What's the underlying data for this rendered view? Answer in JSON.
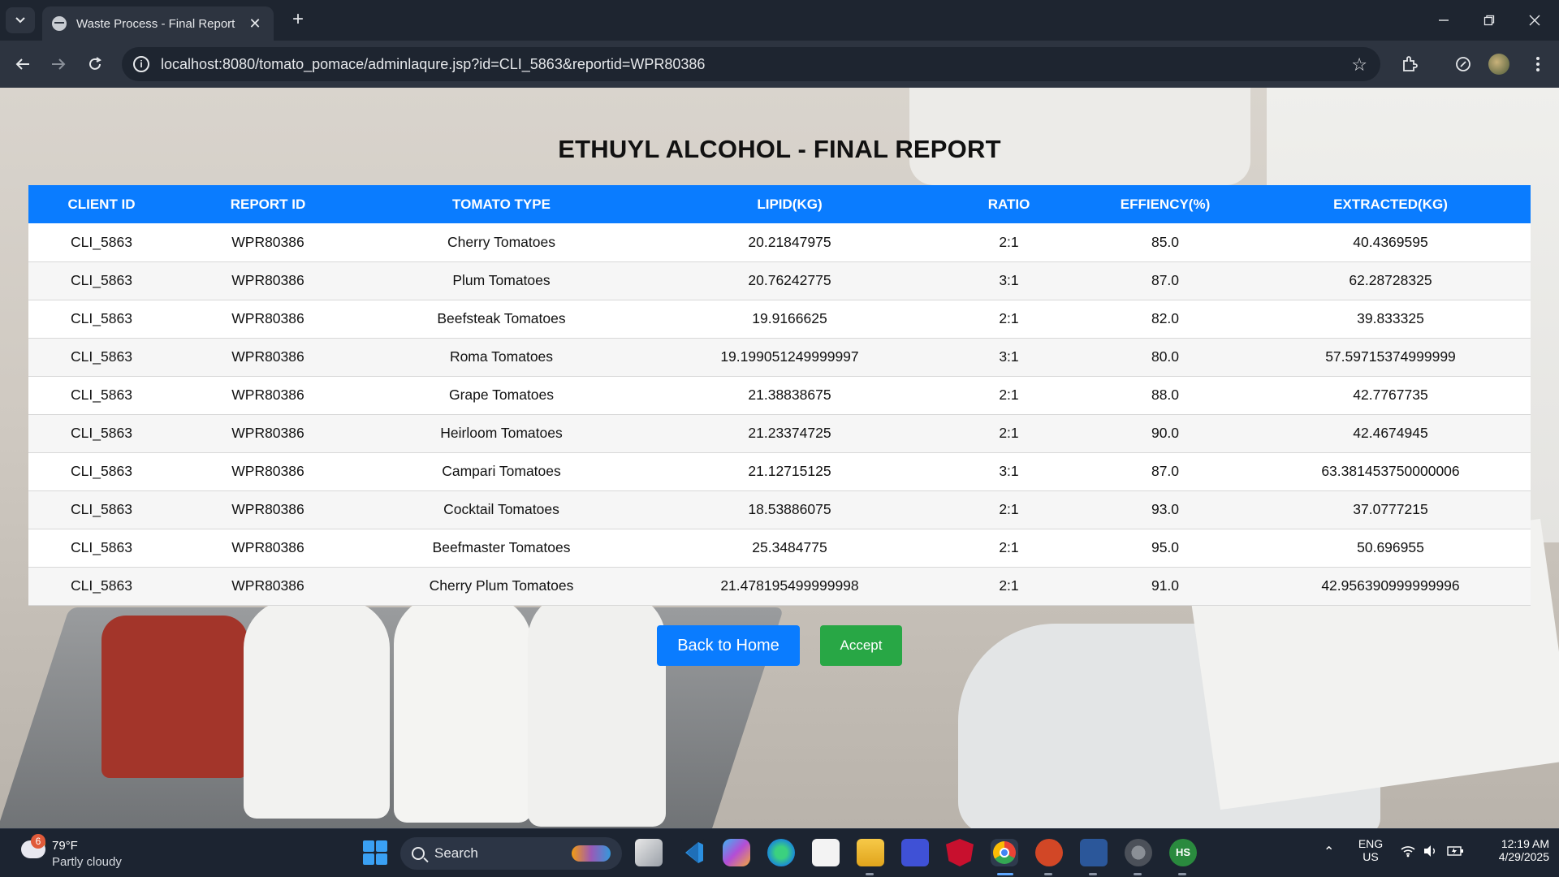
{
  "browser": {
    "tab_title": "Waste Process - Final Report",
    "url": "localhost:8080/tomato_pomace/adminlaqure.jsp?id=CLI_5863&reportid=WPR80386"
  },
  "page": {
    "title": "ETHUYL ALCOHOL - FINAL REPORT",
    "columns": [
      "CLIENT ID",
      "REPORT ID",
      "TOMATO TYPE",
      "LIPID(KG)",
      "RATIO",
      "EFFIENCY(%)",
      "EXTRACTED(KG)"
    ],
    "rows": [
      [
        "CLI_5863",
        "WPR80386",
        "Cherry Tomatoes",
        "20.21847975",
        "2:1",
        "85.0",
        "40.4369595"
      ],
      [
        "CLI_5863",
        "WPR80386",
        "Plum Tomatoes",
        "20.76242775",
        "3:1",
        "87.0",
        "62.28728325"
      ],
      [
        "CLI_5863",
        "WPR80386",
        "Beefsteak Tomatoes",
        "19.9166625",
        "2:1",
        "82.0",
        "39.833325"
      ],
      [
        "CLI_5863",
        "WPR80386",
        "Roma Tomatoes",
        "19.199051249999997",
        "3:1",
        "80.0",
        "57.59715374999999"
      ],
      [
        "CLI_5863",
        "WPR80386",
        "Grape Tomatoes",
        "21.38838675",
        "2:1",
        "88.0",
        "42.7767735"
      ],
      [
        "CLI_5863",
        "WPR80386",
        "Heirloom Tomatoes",
        "21.23374725",
        "2:1",
        "90.0",
        "42.4674945"
      ],
      [
        "CLI_5863",
        "WPR80386",
        "Campari Tomatoes",
        "21.12715125",
        "3:1",
        "87.0",
        "63.381453750000006"
      ],
      [
        "CLI_5863",
        "WPR80386",
        "Cocktail Tomatoes",
        "18.53886075",
        "2:1",
        "93.0",
        "37.0777215"
      ],
      [
        "CLI_5863",
        "WPR80386",
        "Beefmaster Tomatoes",
        "25.3484775",
        "2:1",
        "95.0",
        "50.696955"
      ],
      [
        "CLI_5863",
        "WPR80386",
        "Cherry Plum Tomatoes",
        "21.478195499999998",
        "2:1",
        "91.0",
        "42.956390999999996"
      ]
    ],
    "back_button": "Back to Home",
    "accept_button": "Accept"
  },
  "taskbar": {
    "weather_badge": "6",
    "temperature": "79°F",
    "condition": "Partly cloudy",
    "search_placeholder": "Search",
    "language": "ENG",
    "region": "US",
    "time": "12:19 AM",
    "date": "4/29/2025",
    "profile_initials": "HS"
  },
  "colors": {
    "header_blue": "#0a7cff",
    "accept_green": "#28a745"
  }
}
